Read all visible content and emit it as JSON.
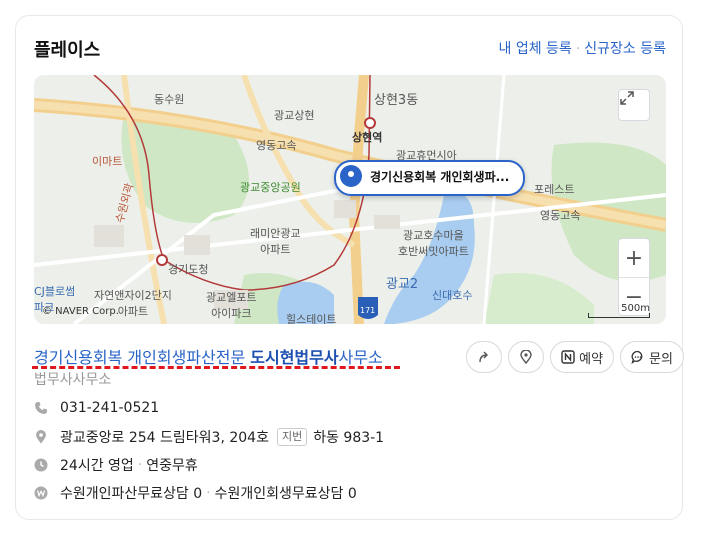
{
  "header": {
    "title": "플레이스",
    "link_register": "내 업체 등록",
    "link_new": "신규장소 등록"
  },
  "map": {
    "pin_label": "경기신용회복 개인회생파...",
    "labels": {
      "sanghyeon3": "상현3동",
      "sanghyeon_station": "상현역",
      "gwanggyo_sanghyeon": "광교상현",
      "dongsuwon": "동수원",
      "emart": "이마트",
      "gwanggyo_park": "광교중앙공원",
      "yeongdong_highway": "영동고속",
      "yeongdong_highway2": "영동고속",
      "gwanggyo_hugeon": "광교휴먼시아",
      "forest": "포레스트",
      "raemian": "래미안광교\n아파트",
      "gyeonggi_office": "경기도청",
      "lake_village": "광교호수마을\n호반써밋아파트",
      "gwanggyo2": "광교2",
      "sindae_lake": "신대호수",
      "jayeon_apt": "자연앤자이2단지\n아파트",
      "gwanggyo_elport": "광교엘포트\n아이파크",
      "hillstate": "힐스테이트",
      "cj_blossom": "CJ블로썸\n파크",
      "ring_road": "수원외곽",
      "route171": "171",
      "naver": "© NAVER Corp.",
      "scale": "500m"
    }
  },
  "place": {
    "name_part1": "경기신용회복 개인회생파산전문 ",
    "name_bold": "도시현법무사",
    "name_part2": "사무소",
    "category": "법무사사무소"
  },
  "actions": {
    "reserve": "예약",
    "inquiry": "문의"
  },
  "info": {
    "phone": "031-241-0521",
    "address": "광교중앙로 254 드림타워3, 204호",
    "jibun_badge": "지번",
    "jibun": "하동 983-1",
    "hours": "24시간 영업",
    "holiday": "연중무휴",
    "keyword1": "수원개인파산무료상담 0",
    "keyword2": "수원개인회생무료상담 0"
  }
}
